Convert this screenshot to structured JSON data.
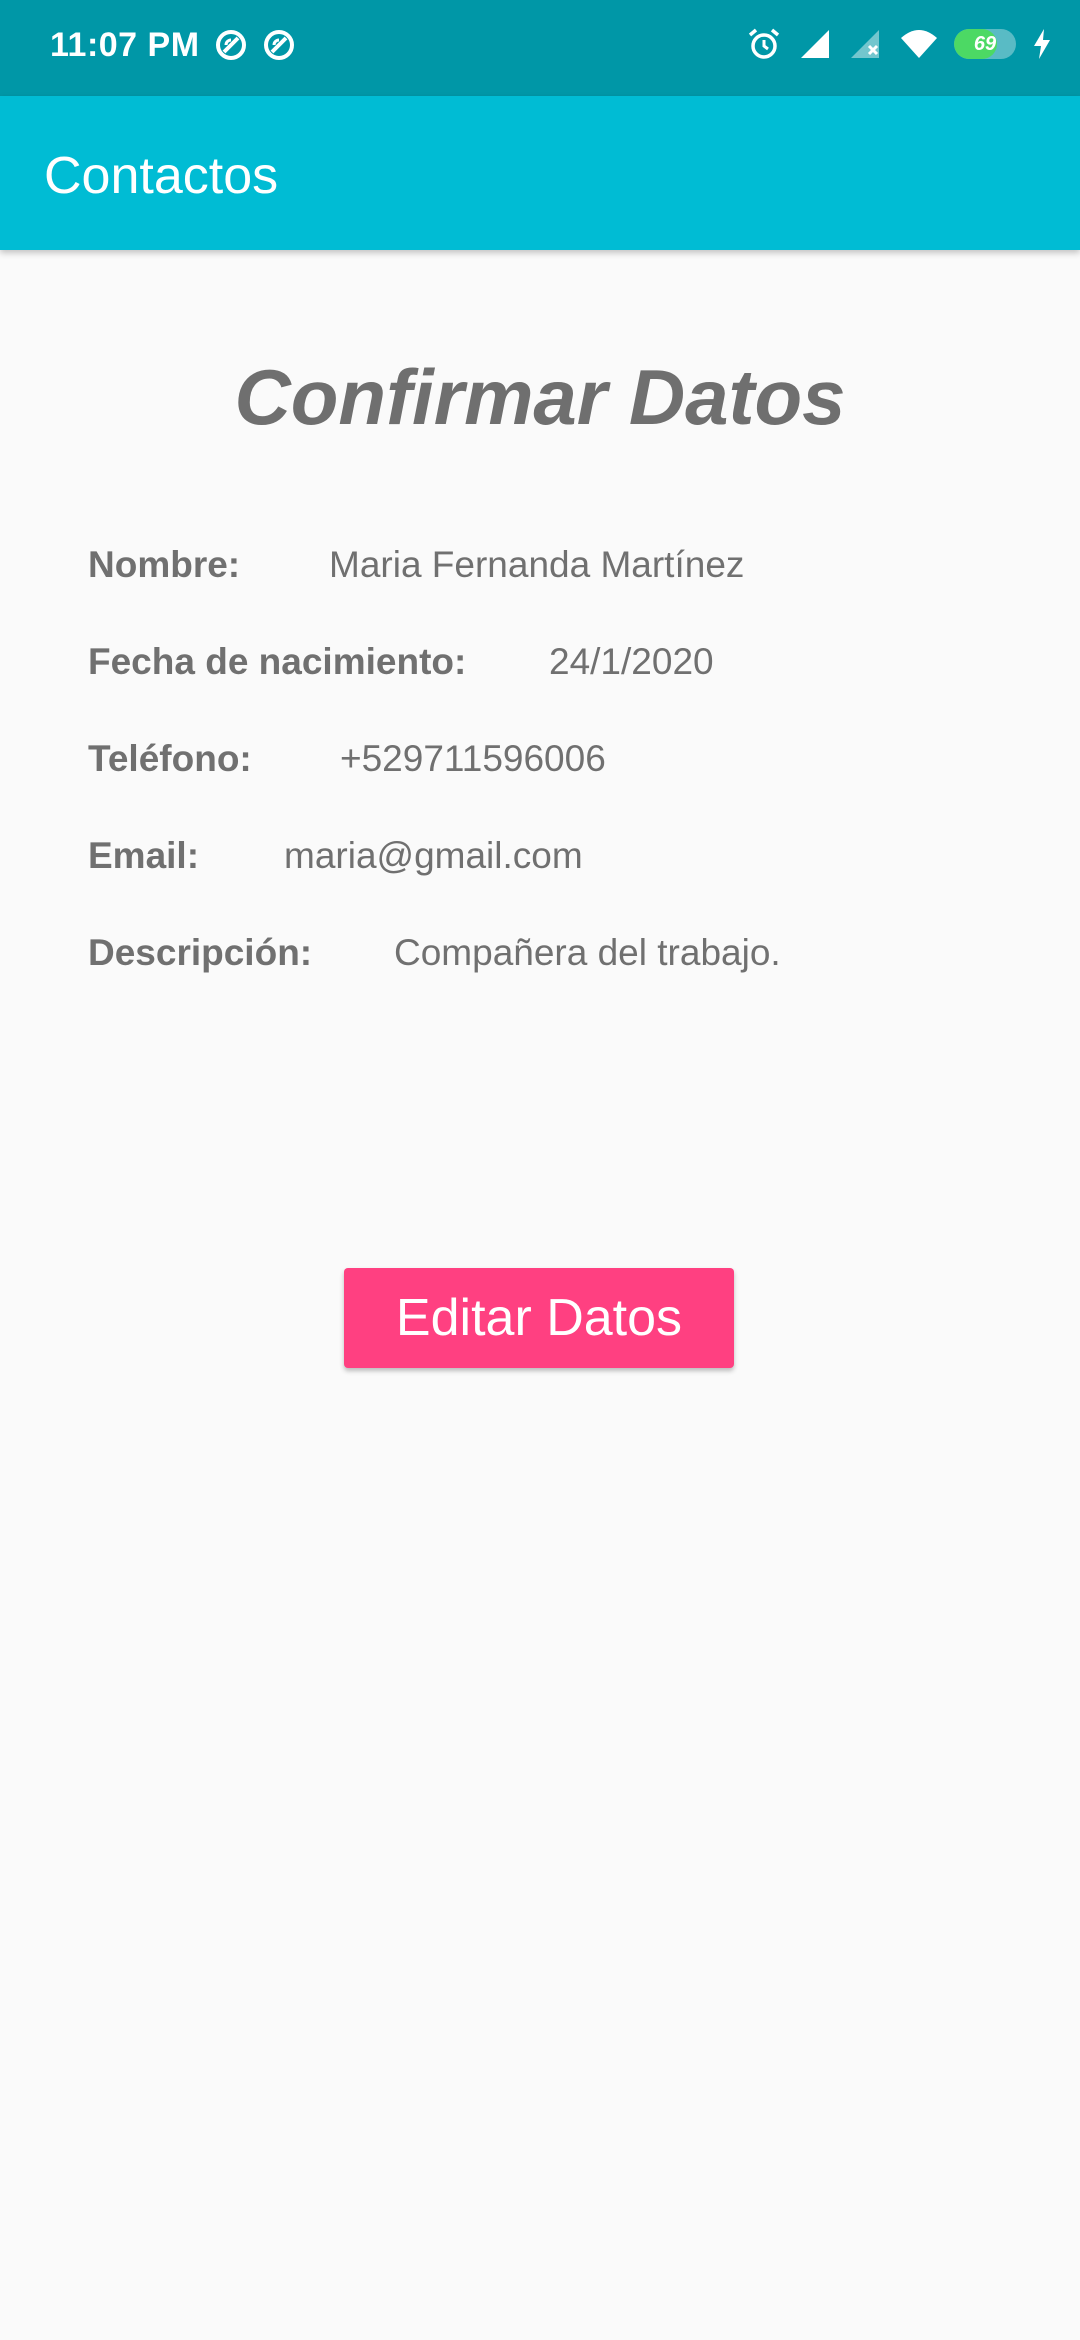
{
  "status_bar": {
    "time": "11:07 PM",
    "battery_level": 69,
    "battery_label": "69",
    "icons": [
      "vpn-icon",
      "vpn-icon",
      "alarm-icon",
      "signal-icon",
      "signal-x-icon",
      "wifi-icon",
      "battery-icon",
      "charging-icon"
    ],
    "background": "#0097A7"
  },
  "app_bar": {
    "title": "Contactos",
    "background": "#00BCD4"
  },
  "main": {
    "heading": "Confirmar Datos",
    "fields": [
      {
        "label": "Nombre:",
        "value": "Maria Fernanda Martínez"
      },
      {
        "label": "Fecha de nacimiento:",
        "value": "24/1/2020"
      },
      {
        "label": "Teléfono:",
        "value": "+529711596006"
      },
      {
        "label": "Email:",
        "value": "maria@gmail.com"
      },
      {
        "label": "Descripción:",
        "value": "Compañera del trabajo."
      }
    ],
    "edit_button_label": "Editar Datos",
    "accent": "#FF4081"
  }
}
